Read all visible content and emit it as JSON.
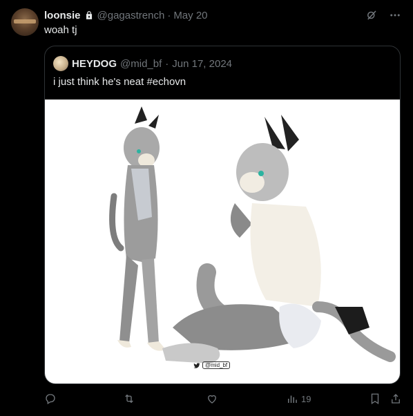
{
  "tweet": {
    "author_name": "loonsie",
    "handle": "@gagastrench",
    "separator": "·",
    "date": "May 20",
    "text": "woah tj",
    "icons": [
      "lock-icon",
      "grok-icon",
      "more-icon"
    ]
  },
  "quote": {
    "author_name": "HEYDOG",
    "handle": "@mid_bf",
    "separator": "·",
    "date": "Jun 17, 2024",
    "text": "i just think he's neat #echovn",
    "image_watermark": "@mid_bf"
  },
  "actions": {
    "views_count": "19",
    "icons": [
      "reply-icon",
      "retweet-icon",
      "like-icon",
      "views-icon",
      "bookmark-icon",
      "share-icon"
    ]
  },
  "colors": {
    "background": "#000000",
    "text": "#e7e9ea",
    "muted": "#71767b",
    "border": "#2f3336"
  }
}
